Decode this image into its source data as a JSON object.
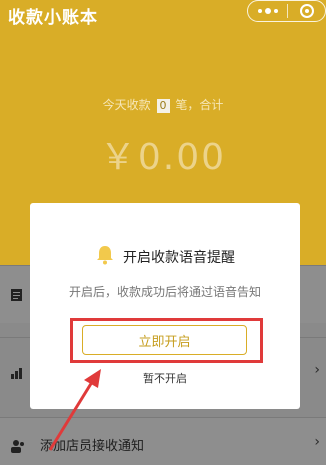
{
  "app": {
    "title": "收款小账本"
  },
  "stats": {
    "prefix": "今天收款",
    "count": "0",
    "suffix": "笔，合计",
    "amount": "￥0.00"
  },
  "list": {
    "items": [
      {
        "icon": "document-icon",
        "label": ""
      },
      {
        "icon": "chart-icon",
        "label": ""
      },
      {
        "icon": "staff-icon",
        "label": "添加店员接收通知"
      }
    ]
  },
  "modal": {
    "title": "开启收款语音提醒",
    "description": "开启后，收款成功后将通过语音告知",
    "enable_label": "立即开启",
    "later_label": "暂不开启"
  },
  "colors": {
    "brand": "#d9ad27",
    "highlight": "#e03a3a"
  }
}
